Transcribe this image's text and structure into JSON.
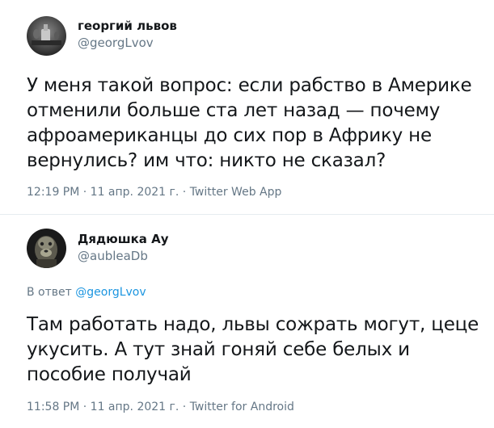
{
  "tweets": [
    {
      "author_name": "георгий львов",
      "author_handle": "@georgLvov",
      "text": "У меня такой вопрос: если рабство в Америке отменили больше ста лет назад — почему афроамериканцы до сих пор в Африку не вернулись? им что: никто не сказал?",
      "meta": "12:19 PM · 11 апр. 2021 г. · Twitter Web App"
    },
    {
      "author_name": "Дядюшка Ау",
      "author_handle": "@aubleaDb",
      "reply_prefix": "В ответ",
      "reply_mention": "@georgLvov",
      "text": "Там работать надо, львы сожрать могут, цеце укусить. А тут знай гоняй себе белых и пособие получай",
      "meta": "11:58 PM · 11 апр. 2021 г. · Twitter for Android"
    }
  ],
  "colors": {
    "text": "#14171a",
    "secondary": "#657786",
    "link": "#1b95e0",
    "divider": "#e6ecf0"
  }
}
